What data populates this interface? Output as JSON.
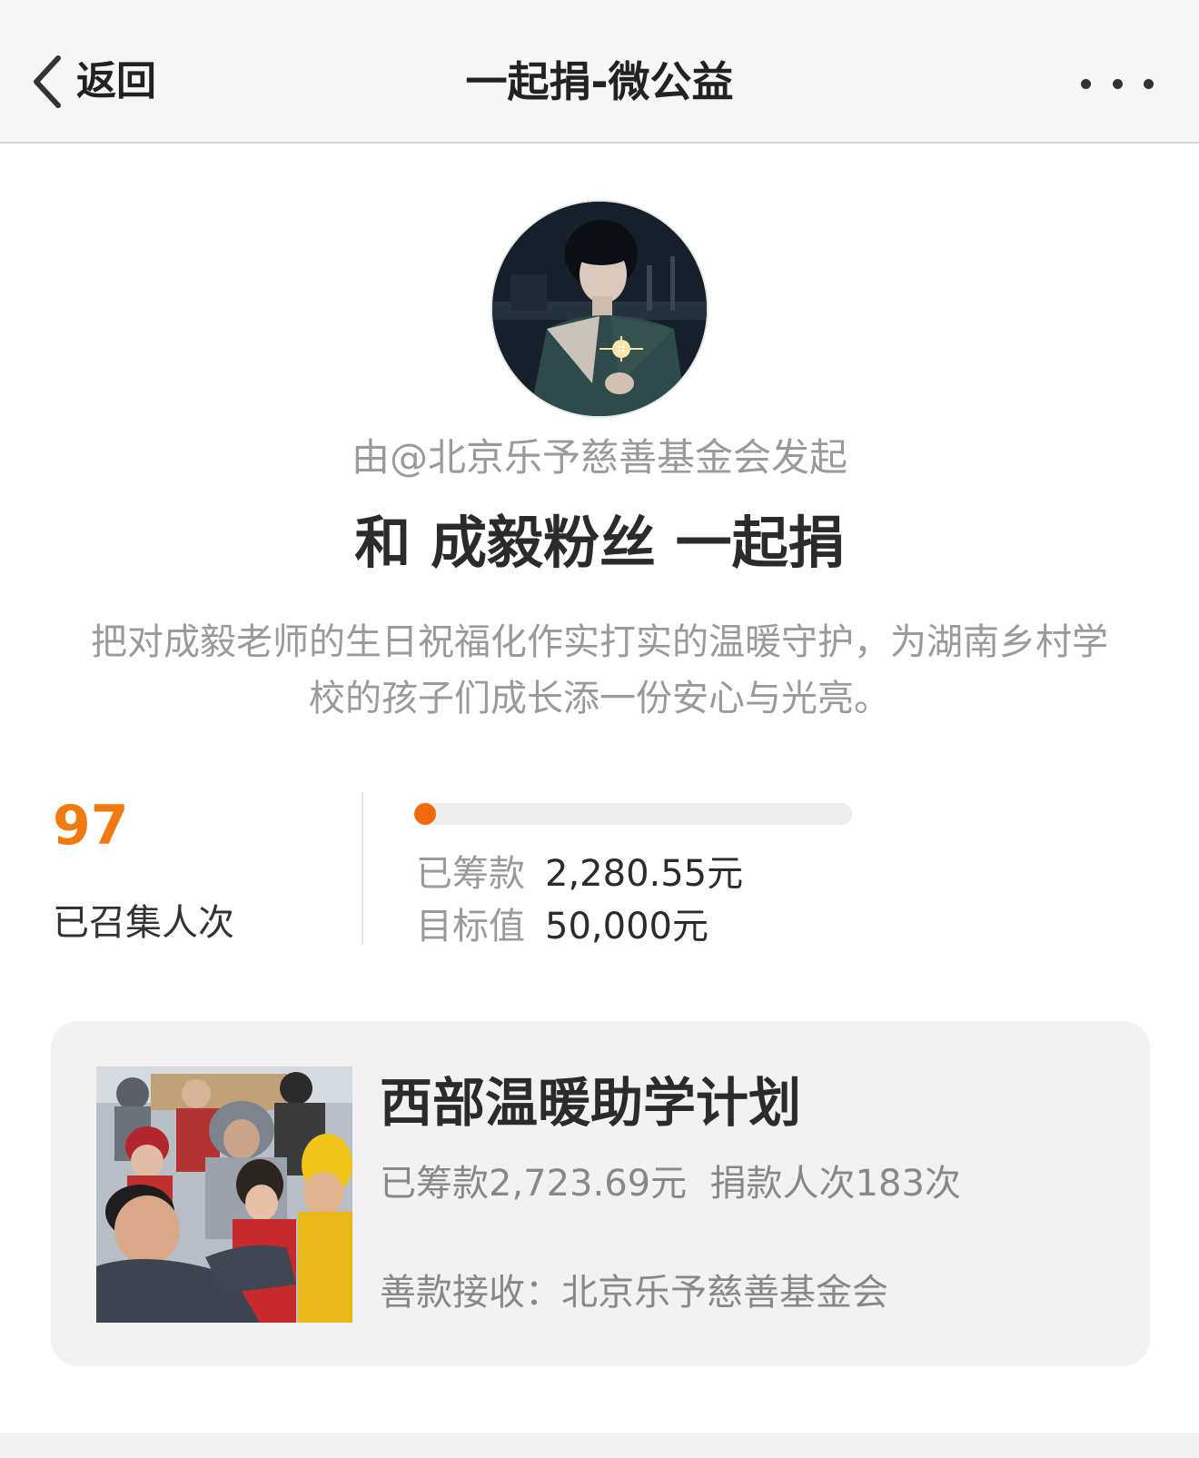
{
  "nav": {
    "back_label": "返回",
    "title": "一起捐-微公益",
    "more_icon": "more-dots-icon",
    "back_icon": "chevron-left-icon"
  },
  "campaign": {
    "initiator": "由@北京乐予慈善基金会发起",
    "headline": "和 成毅粉丝 一起捐",
    "description": "把对成毅老师的生日祝福化作实打实的温暖守护，为湖南乡村学校的孩子们成长添一份安心与光亮。"
  },
  "stats": {
    "count_value": "97",
    "count_label": "已召集人次",
    "raised_label": "已筹款",
    "raised_value": "2,280.55元",
    "target_label": "目标值",
    "target_value": "50,000元",
    "progress_fraction": 0.0456
  },
  "project": {
    "title": "西部温暖助学计划",
    "stats": "已筹款2,723.69元  捐款人次183次",
    "receiver": "善款接收：北京乐予慈善基金会"
  },
  "colors": {
    "accent": "#f07a10",
    "progress_fill": "#f0690e",
    "muted_text": "#9a9a9a",
    "card_bg": "#f2f2f2"
  }
}
